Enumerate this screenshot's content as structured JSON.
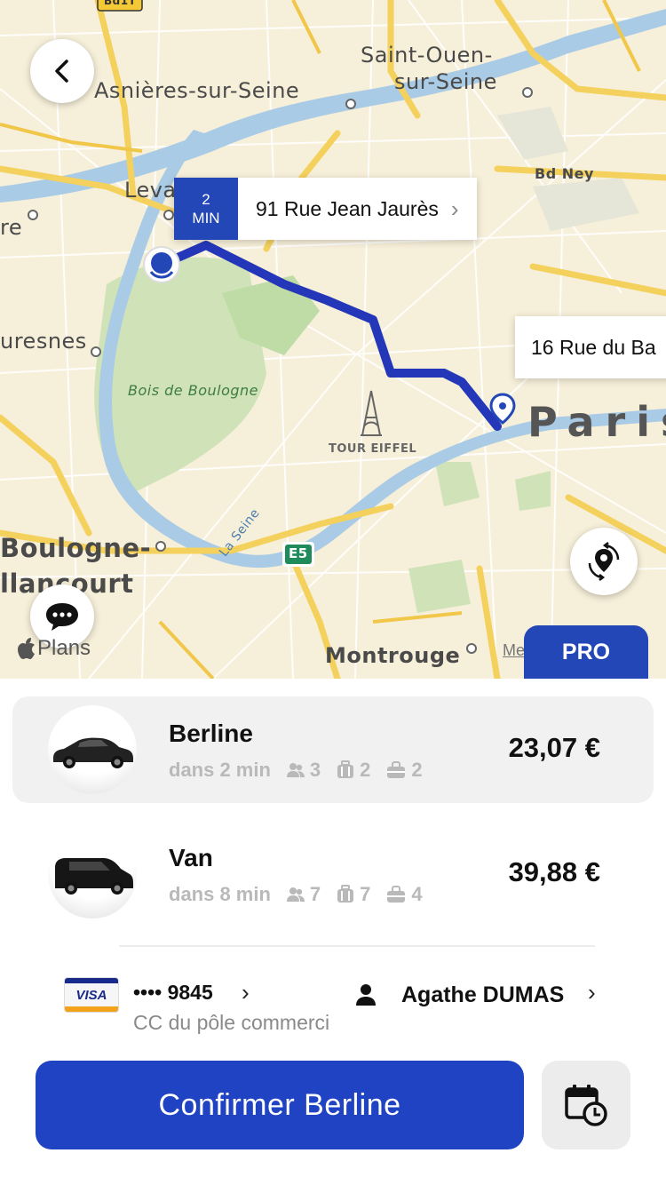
{
  "map": {
    "labels": {
      "asnieres": "Asnières-sur-Seine",
      "saint_ouen_1": "Saint-Ouen-",
      "saint_ouen_2": "sur-Seine",
      "bd_ney": "Bd Ney",
      "levallois": "Leva",
      "re": "re",
      "suresnes": "uresnes",
      "bois": "Bois de Boulogne",
      "tour": "TOUR EIFFEL",
      "paris": "Paris",
      "boulogne_1": "Boulogne-",
      "boulogne_2": "llancourt",
      "la_seine": "La Seine",
      "e5": "E5",
      "montrouge": "Montrouge",
      "sign_top": "Bd1T"
    },
    "origin_callout": {
      "eta_value": "2",
      "eta_unit": "MIN",
      "address": "91 Rue Jean Jaurès"
    },
    "destination_callout": {
      "address": "16 Rue du Ba"
    },
    "provider": "Plans",
    "legal": "Me",
    "pro_badge": "PRO"
  },
  "vehicles": [
    {
      "name": "Berline",
      "eta": "dans 2 min",
      "passengers": "3",
      "luggage": "2",
      "bags": "2",
      "price": "23,07 €",
      "selected": true
    },
    {
      "name": "Van",
      "eta": "dans 8 min",
      "passengers": "7",
      "luggage": "7",
      "bags": "4",
      "price": "39,88 €",
      "selected": false
    }
  ],
  "payment": {
    "card_brand": "VISA",
    "card_number": "•••• 9845",
    "card_label": "CC du pôle commerci",
    "passenger": "Agathe DUMAS"
  },
  "actions": {
    "confirm_label": "Confirmer Berline"
  },
  "colors": {
    "accent": "#1f43c2",
    "route": "#2437b8",
    "selected_bg": "#f1f1f1"
  },
  "icons": {
    "back": "chevron-left-icon",
    "locate": "location-pin-rotate-icon",
    "chat": "chat-bubble-icon",
    "passengers": "people-icon",
    "luggage": "suitcase-icon",
    "bags": "bag-icon",
    "user": "person-icon",
    "schedule": "calendar-clock-icon"
  }
}
